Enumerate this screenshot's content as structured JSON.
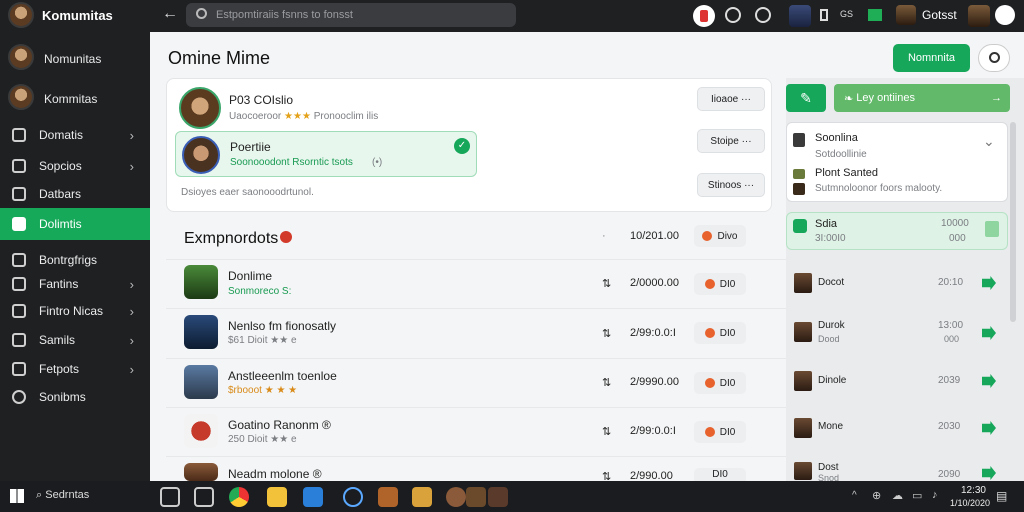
{
  "sidebar": {
    "header": "Komumitas",
    "profiles": [
      "Nomunitas",
      "Kommitas"
    ],
    "items": [
      {
        "label": "Domatis",
        "chev": true
      },
      {
        "label": "Sopcios",
        "chev": true
      },
      {
        "label": "Datbars",
        "chev": false
      },
      {
        "label": "Dolimtis",
        "chev": false,
        "active": true
      },
      {
        "label": "Bontrgfrigs",
        "chev": false
      },
      {
        "label": "Fantins",
        "chev": true
      },
      {
        "label": "Fintro Nicas",
        "chev": true
      },
      {
        "label": "Samils",
        "chev": true
      },
      {
        "label": "Fetpots",
        "chev": true
      },
      {
        "label": "Sonibms",
        "chev": false
      }
    ]
  },
  "topbar": {
    "search_placeholder": "Estpomtiraiis fsnns to fonsst",
    "user": "Gotsst"
  },
  "main": {
    "title": "Omine Mime",
    "primary_button": "Nomnnita",
    "friends": [
      {
        "name": "P03 COIslio",
        "sub": "Uaocoeroor",
        "stars": "★★★",
        "sub2": "Pronooclim ilis"
      },
      {
        "name": "Poertiie",
        "sub": "Soonooodont Rsorntic tsots",
        "sub2": "(•)"
      }
    ],
    "friends_note": "Dsioyes eaer saonooodrtunol.",
    "side_pills": [
      "Iioaoe",
      "Stoipe",
      "Stinoos"
    ],
    "section_title": "Exmpnordots",
    "section_dot_col": "·",
    "section_date": "10/201.00",
    "section_tag": "Divo",
    "rows": [
      {
        "name": "Donlime",
        "sub": "Sonmoreco S:",
        "date": "2/0000.00",
        "tag": "DI0"
      },
      {
        "name": "Nenlso fm fionosatly",
        "sub": "$61 Dioit ★★ e",
        "date": "2/99:0.0:I",
        "tag": "DI0"
      },
      {
        "name": "Anstleeenlm toenloe",
        "sub": "$rbooot ★ ★ ★",
        "date": "2/9990.00",
        "tag": "DI0"
      },
      {
        "name": "Goatino Ranonm ®",
        "sub": "250 Dioit ★★ e",
        "date": "2/99:0.0:I",
        "tag": "DI0"
      },
      {
        "name": "Neadm molone ®",
        "sub": "",
        "date": "2/990.00",
        "tag": "DI0"
      }
    ]
  },
  "right": {
    "top_button": "Ley ontiines",
    "dropdown": [
      {
        "name": "Soonlina",
        "sub": "Sotdoollinie"
      },
      {
        "name": "Plont Santed",
        "sub": "Sutmnoloonor foors malooty."
      }
    ],
    "highlight": {
      "name": "Sdia",
      "sub": "3I:00I0",
      "val1": "10000",
      "val2": "000"
    },
    "list": [
      {
        "name": "Docot",
        "sub": "",
        "val": "20:10"
      },
      {
        "name": "Durok",
        "sub": "Dood",
        "val": "13:00",
        "val2": "000"
      },
      {
        "name": "Dinole",
        "sub": "",
        "val": "2039"
      },
      {
        "name": "Mone",
        "sub": "",
        "val": "2030"
      },
      {
        "name": "Dost",
        "sub": "Snod",
        "val": "2090"
      }
    ]
  },
  "taskbar": {
    "search": "Sedrntas",
    "time": "12:30",
    "date": "1/10/2020"
  }
}
